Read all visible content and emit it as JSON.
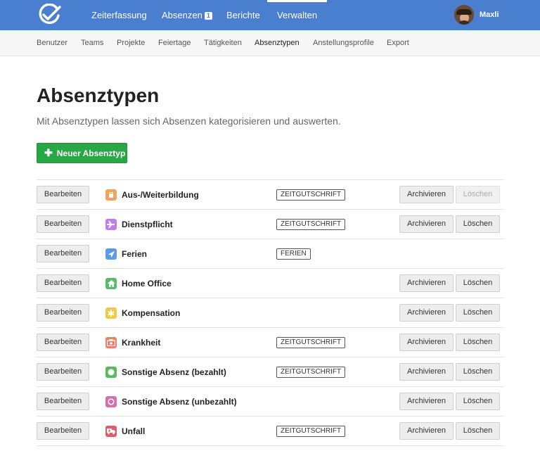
{
  "nav": {
    "items": [
      {
        "label": "Zeiterfassung"
      },
      {
        "label": "Absenzen",
        "badge": "1"
      },
      {
        "label": "Berichte"
      },
      {
        "label": "Verwalten"
      }
    ],
    "user_name": "Maxli"
  },
  "subnav": {
    "items": [
      "Benutzer",
      "Teams",
      "Projekte",
      "Feiertage",
      "Tätigkeiten",
      "Absenztypen",
      "Anstellungsprofile",
      "Export"
    ]
  },
  "page": {
    "title": "Absenztypen",
    "description": "Mit Absenztypen lassen sich Absenzen kategorisieren und auswerten.",
    "new_button": "Neuer Absenztyp"
  },
  "labels": {
    "edit": "Bearbeiten",
    "archive": "Archivieren",
    "delete": "Löschen"
  },
  "colors": {
    "topbar": "#4a7fd0",
    "primary_button": "#28a745"
  },
  "absence_types": [
    {
      "name": "Aus-/Weiterbildung",
      "icon": "book-icon",
      "color": "#f5a35c",
      "tag": "ZEITGUTSCHRIFT",
      "archive": true,
      "delete": true,
      "delete_disabled": true
    },
    {
      "name": "Dienstpflicht",
      "icon": "jet-icon",
      "color": "#c27ce8",
      "tag": "ZEITGUTSCHRIFT",
      "archive": true,
      "delete": true,
      "delete_disabled": false
    },
    {
      "name": "Ferien",
      "icon": "plane-icon",
      "color": "#5b9be8",
      "tag": "FERIEN",
      "archive": false,
      "delete": false,
      "delete_disabled": false
    },
    {
      "name": "Home Office",
      "icon": "home-icon",
      "color": "#5cb86b",
      "tag": "",
      "archive": true,
      "delete": true,
      "delete_disabled": false
    },
    {
      "name": "Kompensation",
      "icon": "asterisk-icon",
      "color": "#f0c94a",
      "tag": "",
      "archive": true,
      "delete": true,
      "delete_disabled": false
    },
    {
      "name": "Krankheit",
      "icon": "medkit-icon",
      "color": "#f07f6a",
      "tag": "ZEITGUTSCHRIFT",
      "archive": true,
      "delete": true,
      "delete_disabled": false
    },
    {
      "name": "Sonstige Absenz (bezahlt)",
      "icon": "circle-icon",
      "color": "#58bb5f",
      "tag": "ZEITGUTSCHRIFT",
      "archive": true,
      "delete": true,
      "delete_disabled": false
    },
    {
      "name": "Sonstige Absenz (unbezahlt)",
      "icon": "circle-outline-icon",
      "color": "#d46fb0",
      "tag": "",
      "archive": true,
      "delete": true,
      "delete_disabled": false
    },
    {
      "name": "Unfall",
      "icon": "ambulance-icon",
      "color": "#e25a66",
      "tag": "ZEITGUTSCHRIFT",
      "archive": true,
      "delete": true,
      "delete_disabled": false
    }
  ]
}
